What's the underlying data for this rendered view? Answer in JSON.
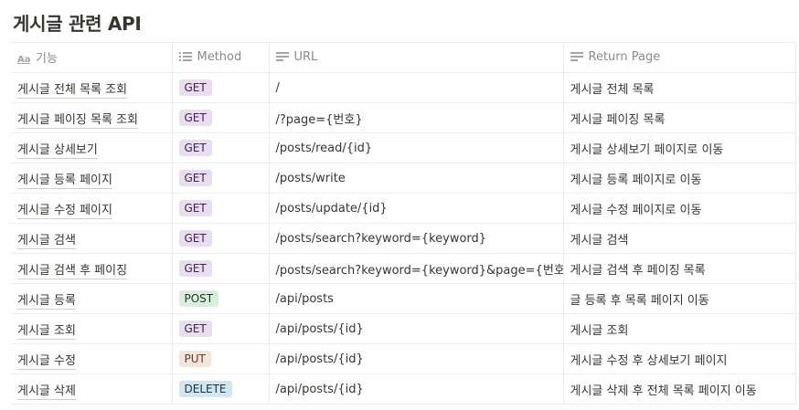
{
  "page": {
    "title": "게시글 관련 API"
  },
  "table": {
    "headers": [
      {
        "label": "기능",
        "icon": "title-property-icon"
      },
      {
        "label": "Method",
        "icon": "list-icon"
      },
      {
        "label": "URL",
        "icon": "text-lines-icon"
      },
      {
        "label": "Return Page",
        "icon": "text-lines-icon"
      }
    ],
    "rows": [
      {
        "name": "게시글 전체 목록 조회",
        "method": "GET",
        "url": "/",
        "ret": "게시글 전체 목록"
      },
      {
        "name": "게시글 페이징 목록 조회",
        "method": "GET",
        "url": "/?page={번호}",
        "ret": "게시글 페이징 목록"
      },
      {
        "name": "게시글 상세보기",
        "method": "GET",
        "url": "/posts/read/{id}",
        "ret": "게시글 상세보기 페이지로 이동"
      },
      {
        "name": "게시글 등록 페이지",
        "method": "GET",
        "url": "/posts/write",
        "ret": "게시글 등록 페이지로 이동"
      },
      {
        "name": "게시글 수정 페이지",
        "method": "GET",
        "url": "/posts/update/{id}",
        "ret": "게시글 수정 페이지로 이동"
      },
      {
        "name": "게시글 검색",
        "method": "GET",
        "url": "/posts/search?keyword={keyword}",
        "ret": "게시글 검색"
      },
      {
        "name": "게시글 검색 후 페이징",
        "method": "GET",
        "url": "/posts/search?keyword={keyword}&page={번호}",
        "ret": "게시글 검색 후 페이징 목록"
      },
      {
        "name": "게시글 등록",
        "method": "POST",
        "url": "/api/posts",
        "ret": "글 등록 후 목록 페이지 이동"
      },
      {
        "name": "게시글 조회",
        "method": "GET",
        "url": "/api/posts/{id}",
        "ret": "게시글 조회"
      },
      {
        "name": "게시글 수정",
        "method": "PUT",
        "url": "/api/posts/{id}",
        "ret": "게시글 수정 후 상세보기 페이지"
      },
      {
        "name": "게시글 삭제",
        "method": "DELETE",
        "url": "/api/posts/{id}",
        "ret": "게시글 삭제 후 전체 목록 페이지 이동"
      }
    ]
  },
  "colors": {
    "GET": "#e8deee",
    "POST": "#dbeddb",
    "PUT": "#f4e6dc",
    "DELETE": "#d3e5ef"
  }
}
